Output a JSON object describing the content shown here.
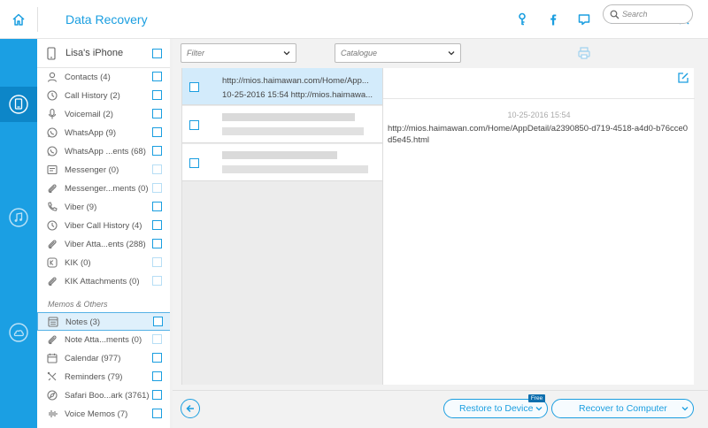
{
  "window": {
    "title": "Data Recovery"
  },
  "device": {
    "name": "Lisa's iPhone"
  },
  "categories": [
    {
      "label": "Contacts (4)",
      "icon": "contact-icon",
      "enabled": true
    },
    {
      "label": "Call History (2)",
      "icon": "clock-icon",
      "enabled": true
    },
    {
      "label": "Voicemail (2)",
      "icon": "mic-icon",
      "enabled": true
    },
    {
      "label": "WhatsApp (9)",
      "icon": "whatsapp-icon",
      "enabled": true
    },
    {
      "label": "WhatsApp ...ents (68)",
      "icon": "whatsapp-icon",
      "enabled": true
    },
    {
      "label": "Messenger (0)",
      "icon": "message-icon",
      "enabled": false
    },
    {
      "label": "Messenger...ments (0)",
      "icon": "paperclip-icon",
      "enabled": false
    },
    {
      "label": "Viber (9)",
      "icon": "phone-icon",
      "enabled": true
    },
    {
      "label": "Viber Call History (4)",
      "icon": "clock-icon",
      "enabled": true
    },
    {
      "label": "Viber Atta...ents (288)",
      "icon": "paperclip-icon",
      "enabled": true
    },
    {
      "label": "KIK (0)",
      "icon": "kik-icon",
      "enabled": false
    },
    {
      "label": "KIK Attachments (0)",
      "icon": "paperclip-icon",
      "enabled": false
    }
  ],
  "memos_section": {
    "heading": "Memos & Others",
    "items": [
      {
        "label": "Notes (3)",
        "icon": "notes-icon",
        "enabled": true,
        "selected": true
      },
      {
        "label": "Note Atta...ments (0)",
        "icon": "paperclip-icon",
        "enabled": false
      },
      {
        "label": "Calendar (977)",
        "icon": "calendar-icon",
        "enabled": true
      },
      {
        "label": "Reminders (79)",
        "icon": "reminder-icon",
        "enabled": true
      },
      {
        "label": "Safari Boo...ark (3761)",
        "icon": "compass-icon",
        "enabled": true
      },
      {
        "label": "Voice Memos (7)",
        "icon": "waveform-icon",
        "enabled": true
      }
    ]
  },
  "toolbar": {
    "filter_placeholder": "Filter",
    "catalogue_placeholder": "Catalogue",
    "search_placeholder": "Search"
  },
  "notes_list": [
    {
      "title": "http://mios.haimawan.com/Home/App...",
      "subtitle": "10-25-2016 15:54   http://mios.haimawa...",
      "selected": true
    }
  ],
  "detail": {
    "date": "10-25-2016 15:54",
    "text": "http://mios.haimawan.com/Home/AppDetail/a2390850-d719-4518-a4d0-b76cce0d5e45.html"
  },
  "actions": {
    "restore_label": "Restore to Device",
    "free_badge": "Free",
    "recover_label": "Recover to Computer"
  },
  "colors": {
    "accent": "#1a9ee0",
    "sidebar": "#1b9fe3",
    "selection": "#d3ebfb"
  }
}
